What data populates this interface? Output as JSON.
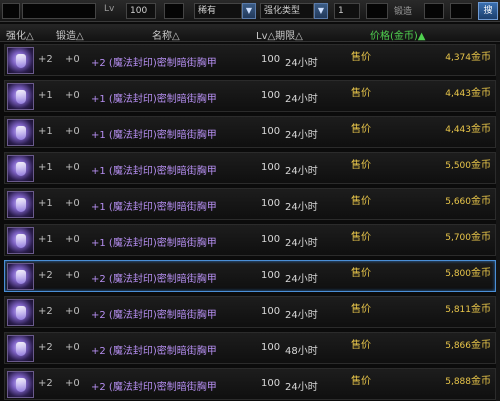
{
  "filters": {
    "level_label": "Lv",
    "level_value": "100",
    "rarity_value": "稀有",
    "enhance_type_value": "强化类型",
    "enhance_amount_value": "1",
    "forge_label": "锻造",
    "search_button_label": "搜"
  },
  "columns": {
    "upgrade": "强化△",
    "amplify": "锻造△",
    "name": "名称△",
    "lv_limit": "Lv△期限△",
    "price": "价格(金币)▲"
  },
  "rows": [
    {
      "upgrade": "+2",
      "amplify": "+0",
      "name": "+2 (魔法封印)密制暗街胸甲",
      "lv": "100",
      "time": "24小时",
      "sell": "售价",
      "price": "4,374",
      "unit": "金币"
    },
    {
      "upgrade": "+1",
      "amplify": "+0",
      "name": "+1 (魔法封印)密制暗街胸甲",
      "lv": "100",
      "time": "24小时",
      "sell": "售价",
      "price": "4,443",
      "unit": "金币"
    },
    {
      "upgrade": "+1",
      "amplify": "+0",
      "name": "+1 (魔法封印)密制暗街胸甲",
      "lv": "100",
      "time": "24小时",
      "sell": "售价",
      "price": "4,443",
      "unit": "金币"
    },
    {
      "upgrade": "+1",
      "amplify": "+0",
      "name": "+1 (魔法封印)密制暗街胸甲",
      "lv": "100",
      "time": "24小时",
      "sell": "售价",
      "price": "5,500",
      "unit": "金币"
    },
    {
      "upgrade": "+1",
      "amplify": "+0",
      "name": "+1 (魔法封印)密制暗街胸甲",
      "lv": "100",
      "time": "24小时",
      "sell": "售价",
      "price": "5,660",
      "unit": "金币"
    },
    {
      "upgrade": "+1",
      "amplify": "+0",
      "name": "+1 (魔法封印)密制暗街胸甲",
      "lv": "100",
      "time": "24小时",
      "sell": "售价",
      "price": "5,700",
      "unit": "金币"
    },
    {
      "upgrade": "+2",
      "amplify": "+0",
      "name": "+2 (魔法封印)密制暗街胸甲",
      "lv": "100",
      "time": "24小时",
      "sell": "售价",
      "price": "5,800",
      "unit": "金币",
      "selected": true
    },
    {
      "upgrade": "+2",
      "amplify": "+0",
      "name": "+2 (魔法封印)密制暗街胸甲",
      "lv": "100",
      "time": "24小时",
      "sell": "售价",
      "price": "5,811",
      "unit": "金币"
    },
    {
      "upgrade": "+2",
      "amplify": "+0",
      "name": "+2 (魔法封印)密制暗街胸甲",
      "lv": "100",
      "time": "48小时",
      "sell": "售价",
      "price": "5,866",
      "unit": "金币"
    },
    {
      "upgrade": "+2",
      "amplify": "+0",
      "name": "+2 (魔法封印)密制暗街胸甲",
      "lv": "100",
      "time": "24小时",
      "sell": "售价",
      "price": "5,888",
      "unit": "金币"
    }
  ],
  "colors": {
    "item_name": "#b58ef0",
    "price_text": "#e9c64a",
    "price_header": "#4fd04f",
    "selection_border": "#4b8fd6"
  }
}
